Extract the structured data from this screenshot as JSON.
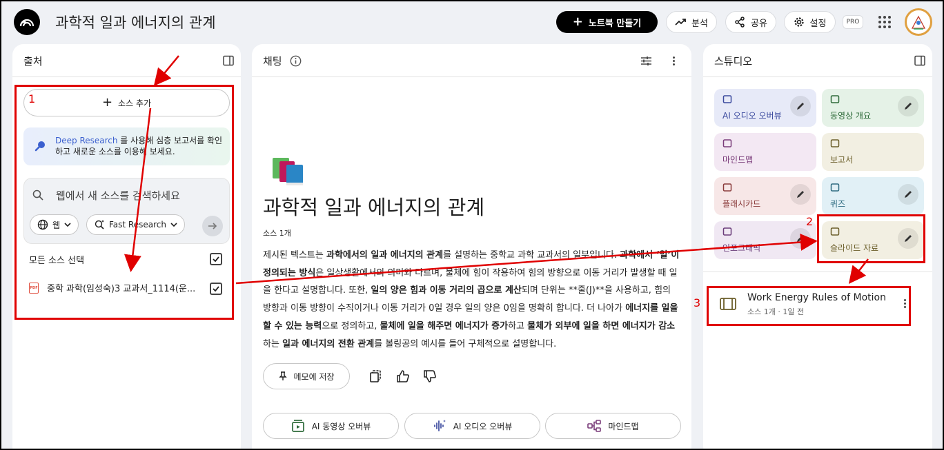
{
  "app": {
    "title": "과학적 일과 에너지의 관계",
    "new_notebook": "노트북 만들기",
    "analysis": "분석",
    "share": "공유",
    "settings": "설정",
    "pro_badge": "PRO"
  },
  "sources": {
    "title": "출처",
    "add_source": "소스 추가",
    "deep_research_link": "Deep Research",
    "deep_research_text": " 를 사용해 심층 보고서를 확인하고 새로운 소스를 이용해 보세요.",
    "search_placeholder": "웹에서 새 소스를 검색하세요",
    "web_chip": "웹",
    "research_chip": "Fast Research",
    "select_all": "모든 소스 선택",
    "items": [
      {
        "name": "중학 과학(임성숙)3 교과서_1114(운..."
      }
    ]
  },
  "chat": {
    "title": "채팅",
    "notebook_title": "과학적 일과 에너지의 관계",
    "source_count": "소스 1개",
    "summary": [
      {
        "t": "제시된 텍스트는 ",
        "b": false
      },
      {
        "t": "과학에서의 일과 에너지의 관계",
        "b": true
      },
      {
        "t": "를 설명하는 중학교 과학 교과서의 일부입니다. ",
        "b": false
      },
      {
        "t": "과학에서 ‘일’이 정의되는 방식",
        "b": true
      },
      {
        "t": "은 일상생활에서의 의미와 다르며, 물체에 힘이 작용하여 힘의 방향으로 이동 거리가 발생할 때 일을 한다고 설명합니다. 또한, ",
        "b": false
      },
      {
        "t": "일의 양은 힘과 이동 거리의 곱으로 계산",
        "b": true
      },
      {
        "t": "되며 단위는 **줄(J)**을 사용하고, 힘의 방향과 이동 방향이 수직이거나 이동 거리가 0일 경우 일의 양은 0임을 명확히 합니다. 더 나아가 ",
        "b": false
      },
      {
        "t": "에너지를 일을 할 수 있는 능력",
        "b": true
      },
      {
        "t": "으로 정의하고, ",
        "b": false
      },
      {
        "t": "물체에 일을 해주면 에너지가 증가",
        "b": true
      },
      {
        "t": "하고 ",
        "b": false
      },
      {
        "t": "물체가 외부에 일을 하면 에너지가 감소",
        "b": true
      },
      {
        "t": "하는 ",
        "b": false
      },
      {
        "t": "일과 에너지의 전환 관계",
        "b": true
      },
      {
        "t": "를 볼링공의 예시를 들어 구체적으로 설명합니다.",
        "b": false
      }
    ],
    "save_note": "메모에 저장",
    "video_overview": "AI 동영상 오버뷰",
    "audio_overview": "AI 오디오 오버뷰",
    "mindmap": "마인드맵"
  },
  "studio": {
    "title": "스튜디오",
    "tiles": [
      {
        "label": "AI 오디오 오버뷰",
        "color": "#e7eaf8",
        "text": "#3b4a9e"
      },
      {
        "label": "동영상 개요",
        "color": "#e5f2e7",
        "text": "#2e6b3a"
      },
      {
        "label": "마인드맵",
        "color": "#f3e8f3",
        "text": "#7a3c7a"
      },
      {
        "label": "보고서",
        "color": "#f2efe2",
        "text": "#6b5e2a"
      },
      {
        "label": "플래시카드",
        "color": "#f7e7e7",
        "text": "#8a3b3b"
      },
      {
        "label": "퀴즈",
        "color": "#e1f0f6",
        "text": "#2e6b80"
      },
      {
        "label": "인포그래픽",
        "color": "#f0e8f3",
        "text": "#6a3c7a"
      },
      {
        "label": "슬라이드 자료",
        "color": "#f2efe2",
        "text": "#6b5e2a"
      }
    ],
    "output": {
      "title": "Work Energy Rules of Motion",
      "meta": "소스 1개 · 1일 전"
    }
  },
  "annotations": {
    "n1": "1",
    "n2": "2",
    "n3": "3"
  }
}
